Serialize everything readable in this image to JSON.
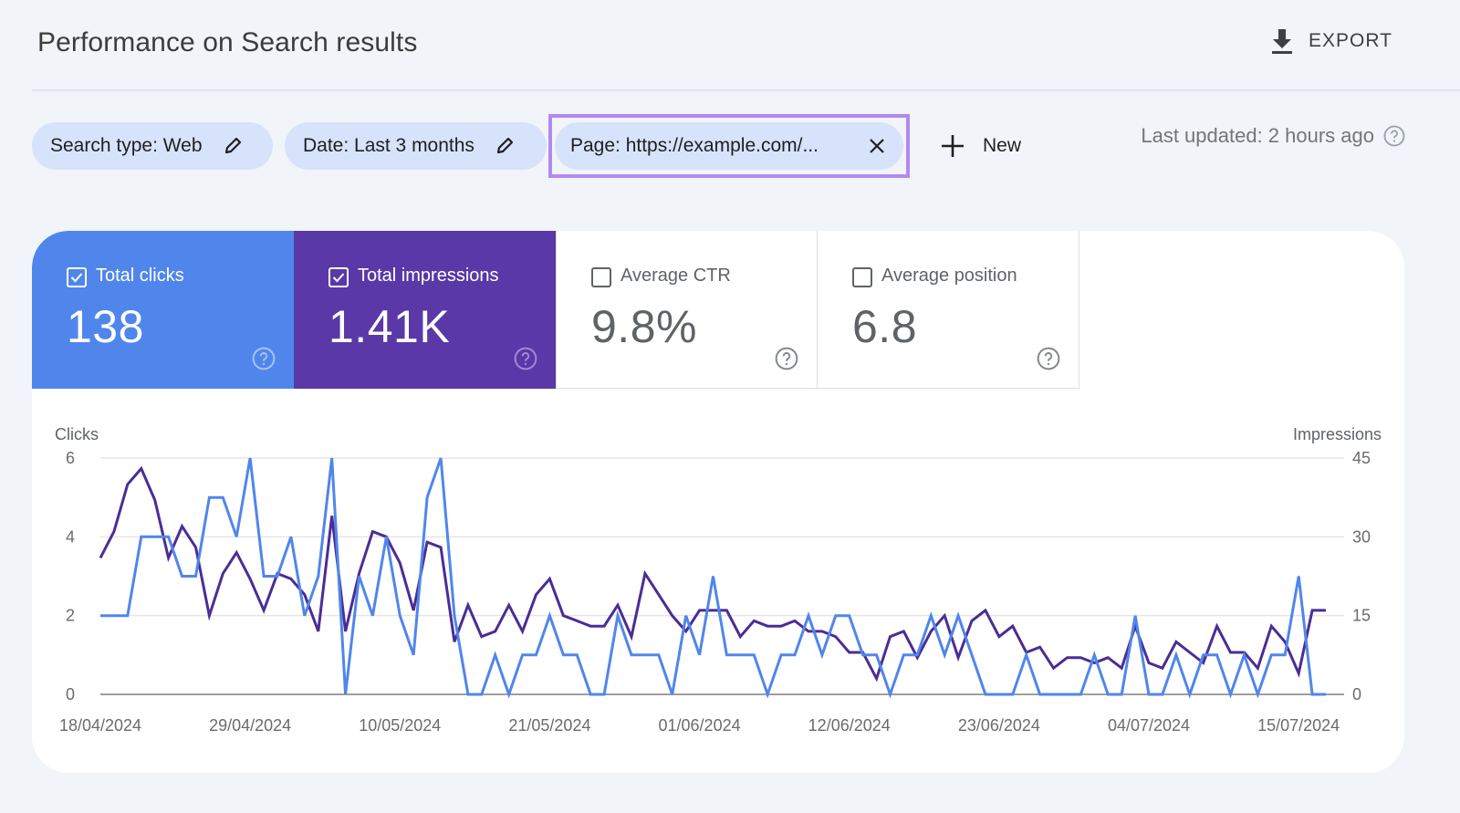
{
  "header": {
    "title": "Performance on Search results",
    "export_label": "EXPORT"
  },
  "filters": {
    "search_type": "Search type: Web",
    "date": "Date: Last 3 months",
    "page": "Page: https://example.com/...",
    "new_label": "New",
    "last_updated": "Last updated: 2 hours ago"
  },
  "metrics": [
    {
      "label": "Total clicks",
      "value": "138",
      "checked": true,
      "color": "#5086ec"
    },
    {
      "label": "Total impressions",
      "value": "1.41K",
      "checked": true,
      "color": "#5a38a7"
    },
    {
      "label": "Average CTR",
      "value": "9.8%",
      "checked": false
    },
    {
      "label": "Average position",
      "value": "6.8",
      "checked": false
    }
  ],
  "colors": {
    "clicks": "#5086ec",
    "impressions": "#4a2d94",
    "highlight": "#b18af0",
    "chip": "#d6e3fa"
  },
  "chart_data": {
    "type": "line",
    "title": "",
    "y_left_label": "Clicks",
    "y_right_label": "Impressions",
    "y_left_ticks": [
      0,
      2,
      4,
      6
    ],
    "y_right_ticks": [
      0,
      15,
      30,
      45
    ],
    "y_left_range": [
      0,
      6
    ],
    "y_right_range": [
      0,
      45
    ],
    "x_tick_labels": [
      "18/04/2024",
      "29/04/2024",
      "10/05/2024",
      "21/05/2024",
      "01/06/2024",
      "12/06/2024",
      "23/06/2024",
      "04/07/2024",
      "15/07/2024"
    ],
    "x_start": "18/04/2024",
    "x_end": "17/07/2024",
    "grid": true,
    "series": [
      {
        "name": "Clicks",
        "axis": "left",
        "color": "#5086ec",
        "values": [
          2,
          2,
          2,
          4,
          4,
          4,
          3,
          3,
          5,
          5,
          4,
          6,
          3,
          3,
          4,
          2,
          3,
          6,
          0,
          3,
          2,
          4,
          2,
          1,
          5,
          6,
          2,
          0,
          0,
          1,
          0,
          1,
          1,
          2,
          1,
          1,
          0,
          0,
          2,
          1,
          1,
          1,
          0,
          2,
          1,
          3,
          1,
          1,
          1,
          0,
          1,
          1,
          2,
          1,
          2,
          2,
          1,
          1,
          0,
          1,
          1,
          2,
          1,
          2,
          1,
          0,
          0,
          0,
          1,
          0,
          0,
          0,
          0,
          1,
          0,
          0,
          2,
          0,
          0,
          1,
          0,
          1,
          1,
          0,
          1,
          0,
          1,
          1,
          3,
          0,
          0
        ]
      },
      {
        "name": "Impressions",
        "axis": "right",
        "color": "#4a2d94",
        "values": [
          26,
          31,
          40,
          43,
          37,
          26,
          32,
          28,
          15,
          23,
          27,
          22,
          16,
          23,
          22,
          19,
          12,
          34,
          12,
          23,
          31,
          30,
          25,
          16,
          29,
          28,
          10,
          17,
          11,
          12,
          17,
          12,
          19,
          22,
          15,
          14,
          13,
          13,
          17,
          11,
          23,
          19,
          15,
          12,
          16,
          16,
          16,
          11,
          14,
          13,
          13,
          14,
          12,
          12,
          11,
          8,
          8,
          3,
          11,
          12,
          7,
          12,
          15,
          7,
          14,
          16,
          11,
          13,
          8,
          9,
          5,
          7,
          7,
          6,
          7,
          5,
          13,
          6,
          5,
          10,
          8,
          6,
          13,
          8,
          8,
          5,
          13,
          10,
          4,
          16,
          16
        ]
      }
    ]
  }
}
